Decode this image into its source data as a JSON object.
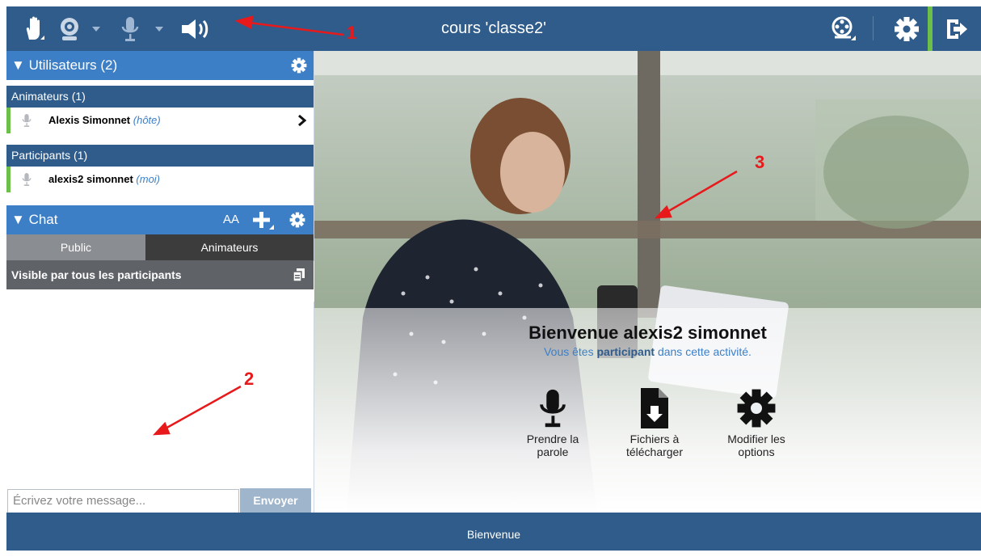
{
  "topbar": {
    "title": "cours 'classe2'",
    "icons": [
      "hand-icon",
      "webcam-icon",
      "microphone-icon",
      "speaker-icon",
      "media-reel-icon",
      "gear-icon",
      "exit-icon"
    ]
  },
  "users_panel": {
    "title": "Utilisateurs (2)",
    "groups": [
      {
        "label": "Animateurs (1)",
        "users": [
          {
            "name": "Alexis Simonnet",
            "role": "(hôte)"
          }
        ]
      },
      {
        "label": "Participants (1)",
        "users": [
          {
            "name": "alexis2 simonnet",
            "role": "(moi)"
          }
        ]
      }
    ]
  },
  "chat": {
    "title": "Chat",
    "font_size_label": "AA",
    "tabs": [
      "Public",
      "Animateurs"
    ],
    "visibility": "Visible par tous les participants",
    "placeholder": "Écrivez votre message...",
    "send_label": "Envoyer"
  },
  "main": {
    "welcome_title": "Bienvenue alexis2 simonnet",
    "welcome_sub_pre": "Vous êtes",
    "welcome_sub_role": "participant",
    "welcome_sub_post": "dans cette activité.",
    "actions": [
      {
        "label1": "Prendre la",
        "label2": "parole",
        "icon": "microphone-icon"
      },
      {
        "label1": "Fichiers à",
        "label2": "télécharger",
        "icon": "file-download-icon"
      },
      {
        "label1": "Modifier les",
        "label2": "options",
        "icon": "gear-icon"
      }
    ]
  },
  "bottombar": {
    "label": "Bienvenue"
  },
  "annotations": [
    "1",
    "2",
    "3"
  ],
  "colors": {
    "header": "#2f5c8a",
    "section_header": "#3d7fc6",
    "accent_green": "#6cc04a",
    "annotation_red": "#e8191b"
  }
}
